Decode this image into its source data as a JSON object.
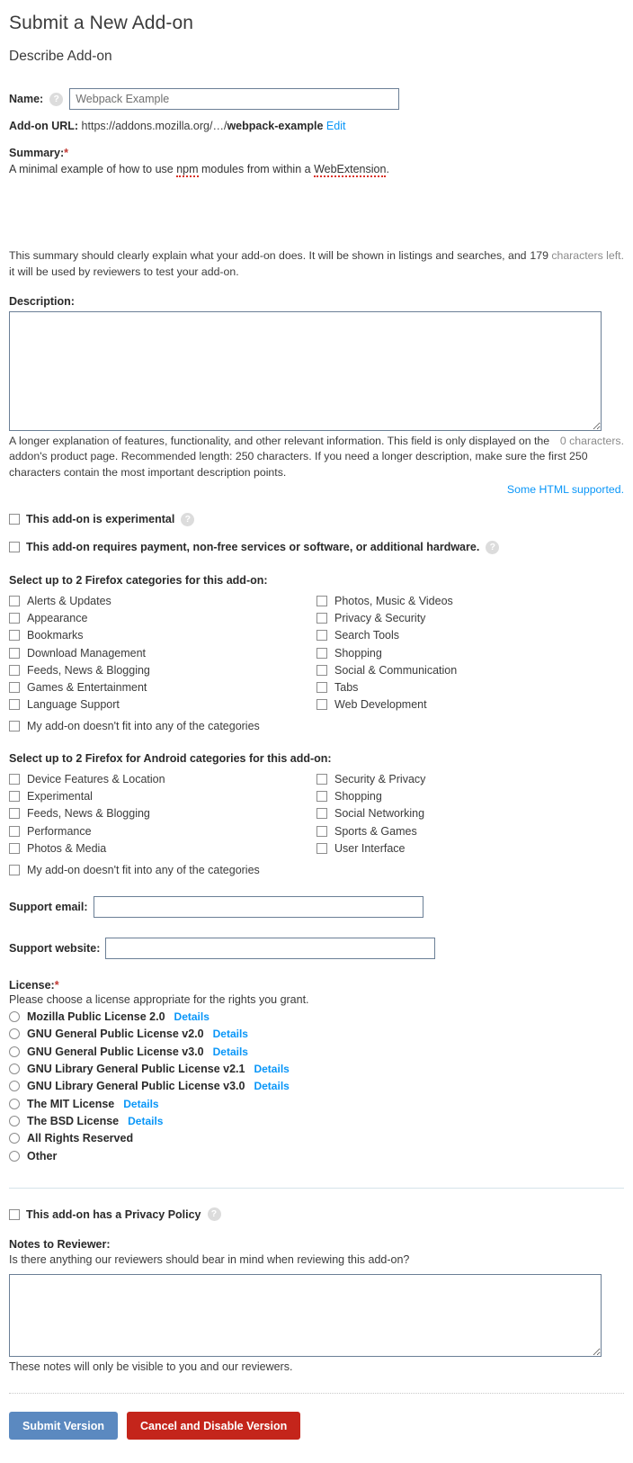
{
  "page": {
    "title": "Submit a New Add-on",
    "section_title": "Describe Add-on"
  },
  "name_field": {
    "label": "Name:",
    "help_icon": "?",
    "value": "Webpack Example"
  },
  "addon_url": {
    "label": "Add-on URL:",
    "base": "https://addons.mozilla.org/…/",
    "slug": "webpack-example",
    "edit_label": "Edit"
  },
  "summary": {
    "label": "Summary:",
    "required_marker": "*",
    "value_part1": "A minimal example of how to use ",
    "value_npm": "npm",
    "value_part2": " modules from within a ",
    "value_webext": "WebExtension",
    "value_part3": ".",
    "help": "This summary should clearly explain what your add-on does. It will be shown in listings and searches, and it will be used by reviewers to test your add-on.",
    "counter_number": "179",
    "counter_suffix": " characters left."
  },
  "description": {
    "label": "Description:",
    "value": "",
    "help": "A longer explanation of features, functionality, and other relevant information. This field is only displayed on the addon's product page. Recommended length: 250 characters. If you need a longer description, make sure the first 250 characters contain the most important description points.",
    "counter": "0 characters.",
    "html_note": "Some HTML supported."
  },
  "flags": [
    {
      "label": "This add-on is experimental",
      "help_icon": "?",
      "checked": false
    },
    {
      "label": "This add-on requires payment, non-free services or software, or additional hardware.",
      "help_icon": "?",
      "checked": false
    }
  ],
  "firefox_categories": {
    "heading": "Select up to 2 Firefox categories for this add-on:",
    "left": [
      "Alerts & Updates",
      "Appearance",
      "Bookmarks",
      "Download Management",
      "Feeds, News & Blogging",
      "Games & Entertainment",
      "Language Support"
    ],
    "right": [
      "Photos, Music & Videos",
      "Privacy & Security",
      "Search Tools",
      "Shopping",
      "Social & Communication",
      "Tabs",
      "Web Development"
    ],
    "no_fit": "My add-on doesn't fit into any of the categories"
  },
  "android_categories": {
    "heading": "Select up to 2 Firefox for Android categories for this add-on:",
    "left": [
      "Device Features & Location",
      "Experimental",
      "Feeds, News & Blogging",
      "Performance",
      "Photos & Media"
    ],
    "right": [
      "Security & Privacy",
      "Shopping",
      "Social Networking",
      "Sports & Games",
      "User Interface"
    ],
    "no_fit": "My add-on doesn't fit into any of the categories"
  },
  "support_email": {
    "label": "Support email:",
    "value": "",
    "placeholder": ""
  },
  "support_website": {
    "label": "Support website:",
    "value": "",
    "placeholder": ""
  },
  "license": {
    "label": "License:",
    "required_marker": "*",
    "intro": "Please choose a license appropriate for the rights you grant.",
    "details_label": "Details",
    "options": [
      {
        "name": "Mozilla Public License 2.0",
        "has_details": true,
        "selected": false
      },
      {
        "name": "GNU General Public License v2.0",
        "has_details": true,
        "selected": false
      },
      {
        "name": "GNU General Public License v3.0",
        "has_details": true,
        "selected": false
      },
      {
        "name": "GNU Library General Public License v2.1",
        "has_details": true,
        "selected": false
      },
      {
        "name": "GNU Library General Public License v3.0",
        "has_details": true,
        "selected": false
      },
      {
        "name": "The MIT License",
        "has_details": true,
        "selected": false
      },
      {
        "name": "The BSD License",
        "has_details": true,
        "selected": false
      },
      {
        "name": "All Rights Reserved",
        "has_details": false,
        "selected": false
      },
      {
        "name": "Other",
        "has_details": false,
        "selected": false
      }
    ]
  },
  "privacy_policy": {
    "label": "This add-on has a Privacy Policy",
    "help_icon": "?",
    "checked": false
  },
  "notes": {
    "title": "Notes to Reviewer:",
    "subtitle": "Is there anything our reviewers should bear in mind when reviewing this add-on?",
    "value": "",
    "footer": "These notes will only be visible to you and our reviewers."
  },
  "actions": {
    "submit_label": "Submit Version",
    "cancel_label": "Cancel and Disable Version",
    "submit_color": "#5b89c0",
    "cancel_color": "#c4251b"
  },
  "colors": {
    "link": "#0996f8",
    "required": "#c13832",
    "input_border": "#6b7f96",
    "text": "#3b3b3b"
  }
}
